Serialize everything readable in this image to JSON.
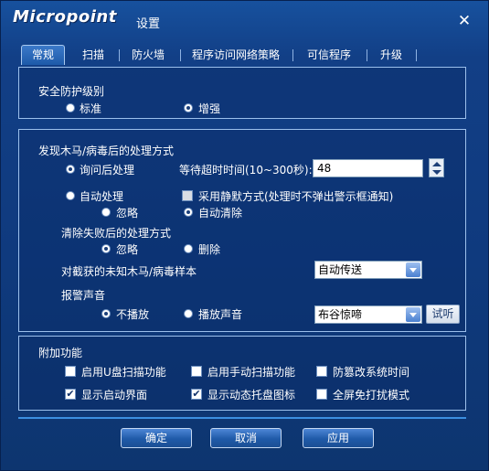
{
  "window": {
    "logo_text": "Micropoint",
    "title": "设置"
  },
  "tabs": [
    "常规",
    "扫描",
    "防火墙",
    "程序访问网络策略",
    "可信程序",
    "升级"
  ],
  "security_level": {
    "heading": "安全防护级别",
    "options": [
      "标准",
      "增强"
    ],
    "selected": "增强"
  },
  "trojan": {
    "heading": "发现木马/病毒后的处理方式",
    "ask_label": "询问后处理",
    "timeout_label": "等待超时时间(10~300秒):",
    "timeout_value": "48",
    "auto_label": "自动处理",
    "silent_label": "采用静默方式(处理时不弹出警示框通知)",
    "ignore_label": "忽略",
    "auto_clear_label": "自动清除",
    "cleanup_heading": "清除失败后的处理方式",
    "cleanup_ignore_label": "忽略",
    "cleanup_delete_label": "删除",
    "unknown_label": "对截获的未知木马/病毒样本",
    "unknown_value": "自动传送",
    "sound_heading": "报警声音",
    "no_sound_label": "不播放",
    "play_sound_label": "播放声音",
    "sound_value": "布谷惊啼",
    "listen_label": "试听"
  },
  "extra": {
    "heading": "附加功能",
    "items": [
      {
        "label": "启用U盘扫描功能",
        "checked": false
      },
      {
        "label": "启用手动扫描功能",
        "checked": false
      },
      {
        "label": "防篡改系统时间",
        "checked": false
      },
      {
        "label": "显示启动界面",
        "checked": true
      },
      {
        "label": "显示动态托盘图标",
        "checked": true
      },
      {
        "label": "全屏免打扰模式",
        "checked": false
      }
    ]
  },
  "buttons": {
    "ok": "确定",
    "cancel": "取消",
    "apply": "应用"
  },
  "colors": {
    "window_bg": "#123f86",
    "panel_border": "#9cc0ec",
    "accent_line": "#3c8fe0"
  }
}
